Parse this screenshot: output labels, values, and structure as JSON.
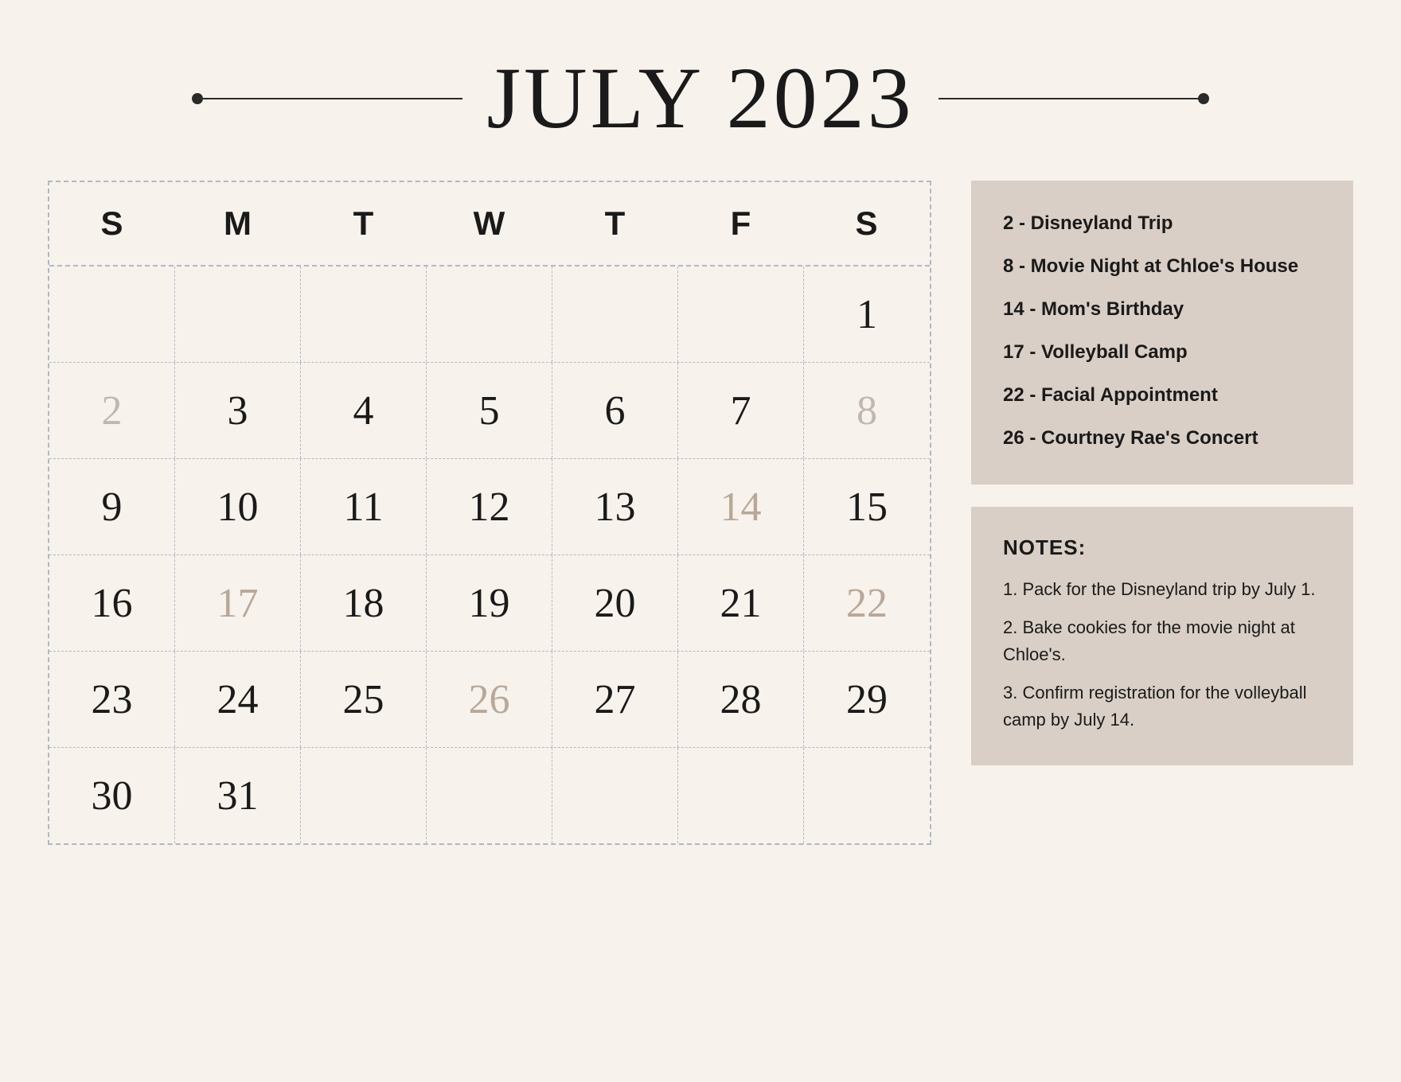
{
  "header": {
    "title": "JULY 2023",
    "line_decoration": "——"
  },
  "calendar": {
    "days_of_week": [
      "S",
      "M",
      "T",
      "W",
      "T",
      "F",
      "S"
    ],
    "weeks": [
      [
        {
          "day": "",
          "muted": false,
          "event": false
        },
        {
          "day": "",
          "muted": false,
          "event": false
        },
        {
          "day": "",
          "muted": false,
          "event": false
        },
        {
          "day": "",
          "muted": false,
          "event": false
        },
        {
          "day": "",
          "muted": false,
          "event": false
        },
        {
          "day": "",
          "muted": false,
          "event": false
        },
        {
          "day": "1",
          "muted": false,
          "event": false
        }
      ],
      [
        {
          "day": "2",
          "muted": true,
          "event": false
        },
        {
          "day": "3",
          "muted": false,
          "event": false
        },
        {
          "day": "4",
          "muted": false,
          "event": false
        },
        {
          "day": "5",
          "muted": false,
          "event": false
        },
        {
          "day": "6",
          "muted": false,
          "event": false
        },
        {
          "day": "7",
          "muted": false,
          "event": false
        },
        {
          "day": "8",
          "muted": true,
          "event": false
        }
      ],
      [
        {
          "day": "9",
          "muted": false,
          "event": false
        },
        {
          "day": "10",
          "muted": false,
          "event": false
        },
        {
          "day": "11",
          "muted": false,
          "event": false
        },
        {
          "day": "12",
          "muted": false,
          "event": false
        },
        {
          "day": "13",
          "muted": false,
          "event": false
        },
        {
          "day": "14",
          "muted": false,
          "event": true
        },
        {
          "day": "15",
          "muted": false,
          "event": false
        }
      ],
      [
        {
          "day": "16",
          "muted": false,
          "event": false
        },
        {
          "day": "17",
          "muted": false,
          "event": true
        },
        {
          "day": "18",
          "muted": false,
          "event": false
        },
        {
          "day": "19",
          "muted": false,
          "event": false
        },
        {
          "day": "20",
          "muted": false,
          "event": false
        },
        {
          "day": "21",
          "muted": false,
          "event": false
        },
        {
          "day": "22",
          "muted": false,
          "event": true
        }
      ],
      [
        {
          "day": "23",
          "muted": false,
          "event": false
        },
        {
          "day": "24",
          "muted": false,
          "event": false
        },
        {
          "day": "25",
          "muted": false,
          "event": false
        },
        {
          "day": "26",
          "muted": false,
          "event": true
        },
        {
          "day": "27",
          "muted": false,
          "event": false
        },
        {
          "day": "28",
          "muted": false,
          "event": false
        },
        {
          "day": "29",
          "muted": false,
          "event": false
        }
      ],
      [
        {
          "day": "30",
          "muted": false,
          "event": false
        },
        {
          "day": "31",
          "muted": false,
          "event": false
        },
        {
          "day": "",
          "muted": false,
          "event": false
        },
        {
          "day": "",
          "muted": false,
          "event": false
        },
        {
          "day": "",
          "muted": false,
          "event": false
        },
        {
          "day": "",
          "muted": false,
          "event": false
        },
        {
          "day": "",
          "muted": false,
          "event": false
        }
      ]
    ]
  },
  "events": [
    {
      "label": "2 - Disneyland Trip"
    },
    {
      "label": "8 - Movie Night at Chloe's House"
    },
    {
      "label": "14 - Mom's Birthday"
    },
    {
      "label": "17 - Volleyball Camp"
    },
    {
      "label": "22 - Facial Appointment"
    },
    {
      "label": "26 - Courtney Rae's Concert"
    }
  ],
  "notes": {
    "title": "NOTES:",
    "items": [
      {
        "text": "1. Pack for the Disneyland trip by July 1."
      },
      {
        "text": "2. Bake cookies for the movie night at Chloe's."
      },
      {
        "text": "3. Confirm registration for the volleyball camp by July 14."
      }
    ]
  }
}
